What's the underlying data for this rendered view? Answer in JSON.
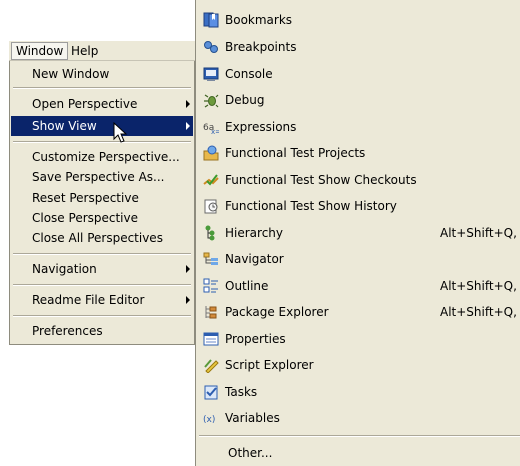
{
  "menubar": {
    "window_label": "Window",
    "help_label": "Help"
  },
  "window_menu": {
    "items": [
      {
        "label": "New Window"
      },
      {
        "label": "Open Perspective"
      },
      {
        "label": "Show View"
      },
      {
        "label": "Customize Perspective..."
      },
      {
        "label": "Save Perspective As..."
      },
      {
        "label": "Reset Perspective"
      },
      {
        "label": "Close Perspective"
      },
      {
        "label": "Close All Perspectives"
      },
      {
        "label": "Navigation"
      },
      {
        "label": "Readme File Editor"
      },
      {
        "label": "Preferences"
      }
    ]
  },
  "show_view_menu": {
    "items": [
      {
        "label": "Bookmarks",
        "icon": "bookmarks-icon"
      },
      {
        "label": "Breakpoints",
        "icon": "breakpoints-icon"
      },
      {
        "label": "Console",
        "icon": "console-icon"
      },
      {
        "label": "Debug",
        "icon": "debug-icon"
      },
      {
        "label": "Expressions",
        "icon": "expressions-icon"
      },
      {
        "label": "Functional Test Projects",
        "icon": "functional-test-projects-icon"
      },
      {
        "label": "Functional Test Show Checkouts",
        "icon": "show-checkouts-icon"
      },
      {
        "label": "Functional Test Show History",
        "icon": "show-history-icon"
      },
      {
        "label": "Hierarchy",
        "icon": "hierarchy-icon",
        "shortcut": "Alt+Shift+Q, T"
      },
      {
        "label": "Navigator",
        "icon": "navigator-icon"
      },
      {
        "label": "Outline",
        "icon": "outline-icon",
        "shortcut": "Alt+Shift+Q, O"
      },
      {
        "label": "Package Explorer",
        "icon": "package-explorer-icon",
        "shortcut": "Alt+Shift+Q, P"
      },
      {
        "label": "Properties",
        "icon": "properties-icon"
      },
      {
        "label": "Script Explorer",
        "icon": "script-explorer-icon"
      },
      {
        "label": "Tasks",
        "icon": "tasks-icon"
      },
      {
        "label": "Variables",
        "icon": "variables-icon"
      }
    ],
    "other_label": "Other..."
  },
  "colors": {
    "menu_bg": "#ece9d8",
    "selection_bg": "#0a246a",
    "selection_fg": "#ffffff"
  }
}
